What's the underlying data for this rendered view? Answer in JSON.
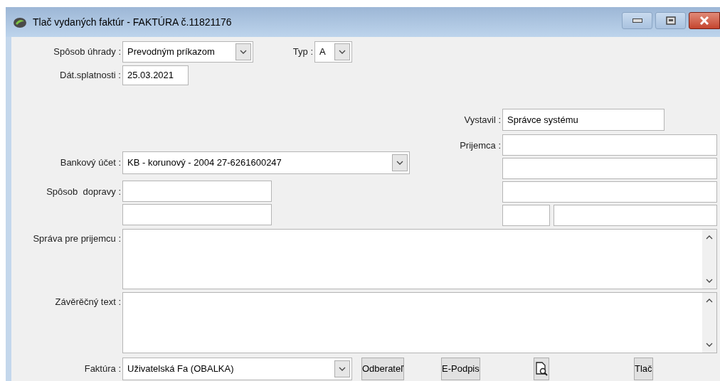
{
  "window": {
    "title": "Tlač vydaných faktúr - FAKTÚRA č.11821176"
  },
  "form": {
    "payment_method": {
      "label": "Spôsob úhrady :",
      "value": "Prevodným príkazom"
    },
    "type": {
      "label": "Typ :",
      "value": "A"
    },
    "due_date": {
      "label": "Dát.splatnosti :",
      "value": "25.03.2021"
    },
    "issued_by": {
      "label": "Vystavil :",
      "value": "Správce systému"
    },
    "recipient": {
      "label": "Prijemca :"
    },
    "bank_account": {
      "label": "Bankový účet :",
      "value": "KB - korunový - 2004 27-6261600247"
    },
    "transport": {
      "label": "Spôsob  dopravy :"
    },
    "message": {
      "label": "Správa pre prijemcu :"
    },
    "closing_text": {
      "label": "Závěrěčný text :"
    },
    "invoice": {
      "label": "Faktúra :",
      "value": "Uživatelská Fa (OBALKA)"
    }
  },
  "buttons": [
    {
      "kind": "text",
      "label": "Odberateľ"
    },
    {
      "kind": "text",
      "label": "E-Podpis"
    },
    {
      "kind": "icon"
    },
    {
      "kind": "text",
      "label": "Tlač"
    }
  ]
}
